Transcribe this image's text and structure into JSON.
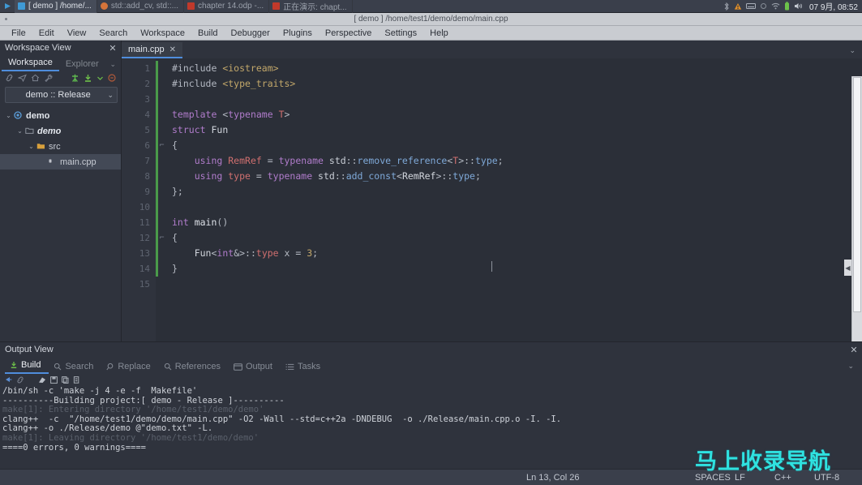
{
  "taskbar": {
    "items": [
      {
        "label": "[ demo ] /home/...",
        "active": true,
        "color": "#3f9ad6"
      },
      {
        "label": "std::add_cv, std::...",
        "active": false,
        "color": "#d4743a"
      },
      {
        "label": "chapter 14.odp -...",
        "active": false,
        "color": "#c0392b"
      },
      {
        "label": "正在演示: chapt...",
        "active": false,
        "color": "#c0392b"
      }
    ],
    "clock": "07 9月, 08:52",
    "tray_icons": [
      "bluetooth-icon",
      "warning-icon",
      "keyboard-icon",
      "display-icon",
      "wifi-icon",
      "battery-icon",
      "volume-icon"
    ]
  },
  "titlebar": {
    "title": "[ demo ] /home/test1/demo/demo/main.cpp"
  },
  "menubar": {
    "items": [
      "File",
      "Edit",
      "View",
      "Search",
      "Workspace",
      "Build",
      "Debugger",
      "Plugins",
      "Perspective",
      "Settings",
      "Help"
    ]
  },
  "sidebar": {
    "title": "Workspace View",
    "close_label": "✕",
    "tabs": [
      {
        "label": "Workspace",
        "active": true
      },
      {
        "label": "Explorer",
        "active": false
      }
    ],
    "tabs_chevron": "⌄",
    "tools": [
      "link-icon",
      "send-icon",
      "home-icon",
      "wrench-icon",
      "run-icon",
      "build-icon",
      "check-icon",
      "stop-icon"
    ],
    "target_combo": {
      "value": "demo :: Release",
      "chevron": "⌄"
    },
    "tree": [
      {
        "depth": 0,
        "twisty": "⌄",
        "icon": "project-icon",
        "label": "demo",
        "style": "bold",
        "selected": false
      },
      {
        "depth": 1,
        "twisty": "⌄",
        "icon": "folder-outline-icon",
        "label": "demo",
        "style": "ital",
        "selected": false
      },
      {
        "depth": 2,
        "twisty": "⌄",
        "icon": "folder-icon",
        "label": "src",
        "style": "plain",
        "selected": false
      },
      {
        "depth": 3,
        "twisty": "",
        "icon": "cpp-file-icon",
        "label": "main.cpp",
        "style": "plain",
        "selected": true
      }
    ]
  },
  "editor": {
    "tab": {
      "label": "main.cpp",
      "close": "✕"
    },
    "chevron": "⌄",
    "line_numbers": [
      "1",
      "2",
      "3",
      "4",
      "5",
      "6",
      "7",
      "8",
      "9",
      "10",
      "11",
      "12",
      "13",
      "14",
      "15"
    ],
    "fold_marks": [
      "",
      "",
      "",
      "",
      "",
      "⌐",
      "",
      "",
      "",
      "",
      "",
      "⌐",
      "",
      "",
      ""
    ],
    "lines": [
      [
        [
          "#include ",
          "k-pre"
        ],
        [
          "<iostream>",
          "k-str"
        ]
      ],
      [
        [
          "#include ",
          "k-pre"
        ],
        [
          "<type_traits>",
          "k-str"
        ]
      ],
      [],
      [
        [
          "template ",
          "k-kw"
        ],
        [
          "<",
          "k-op"
        ],
        [
          "typename ",
          "k-kw"
        ],
        [
          "T",
          "k-tmpl"
        ],
        [
          ">",
          "k-op"
        ]
      ],
      [
        [
          "struct ",
          "k-kw"
        ],
        [
          "Fun",
          "k-ident"
        ]
      ],
      [
        [
          "{",
          "k-op"
        ]
      ],
      [
        [
          "    using ",
          "k-kw"
        ],
        [
          "RemRef",
          "k-tmpl"
        ],
        [
          " = ",
          "k-op"
        ],
        [
          "typename ",
          "k-kw"
        ],
        [
          "std",
          "k-ns"
        ],
        [
          "::",
          "k-op"
        ],
        [
          "remove_reference",
          "k-std"
        ],
        [
          "<",
          "k-op"
        ],
        [
          "T",
          "k-tmpl"
        ],
        [
          ">::",
          "k-op"
        ],
        [
          "type",
          "k-std"
        ],
        [
          ";",
          "k-op"
        ]
      ],
      [
        [
          "    using ",
          "k-kw"
        ],
        [
          "type",
          "k-tmpl"
        ],
        [
          " = ",
          "k-op"
        ],
        [
          "typename ",
          "k-kw"
        ],
        [
          "std",
          "k-ns"
        ],
        [
          "::",
          "k-op"
        ],
        [
          "add_const",
          "k-std"
        ],
        [
          "<",
          "k-op"
        ],
        [
          "RemRef",
          "k-ident"
        ],
        [
          ">::",
          "k-op"
        ],
        [
          "type",
          "k-std"
        ],
        [
          ";",
          "k-op"
        ]
      ],
      [
        [
          "};",
          "k-op"
        ]
      ],
      [],
      [
        [
          "int ",
          "k-kw"
        ],
        [
          "main",
          "k-fn"
        ],
        [
          "()",
          "k-op"
        ]
      ],
      [
        [
          "{",
          "k-op"
        ]
      ],
      [
        [
          "    Fun",
          "k-ident"
        ],
        [
          "<",
          "k-op"
        ],
        [
          "int",
          "k-kw"
        ],
        [
          "&>::",
          "k-op"
        ],
        [
          "type",
          "k-tmpl"
        ],
        [
          " x = ",
          "k-op"
        ],
        [
          "3",
          "k-num"
        ],
        [
          ";",
          "k-op"
        ]
      ],
      [
        [
          "}",
          "k-op"
        ]
      ],
      []
    ]
  },
  "output": {
    "title": "Output View",
    "close_label": "✕",
    "chevron": "⌄",
    "tabs": [
      {
        "label": "Build",
        "icon": "build-icon",
        "active": true
      },
      {
        "label": "Search",
        "icon": "search-icon",
        "active": false
      },
      {
        "label": "Replace",
        "icon": "replace-icon",
        "active": false
      },
      {
        "label": "References",
        "icon": "search-icon",
        "active": false
      },
      {
        "label": "Output",
        "icon": "output-icon",
        "active": false
      },
      {
        "label": "Tasks",
        "icon": "tasks-icon",
        "active": false
      }
    ],
    "tools": [
      "pin-icon",
      "link-icon",
      "clear-icon",
      "save-icon",
      "copy-icon",
      "copy-all-icon"
    ],
    "log": [
      {
        "text": "/bin/sh -c 'make -j 4 -e -f  Makefile'",
        "dim": false
      },
      {
        "text": "----------Building project:[ demo - Release ]----------",
        "dim": false
      },
      {
        "text": "make[1]: Entering directory '/home/test1/demo/demo'",
        "dim": true
      },
      {
        "text": "clang++  -c  \"/home/test1/demo/demo/main.cpp\" -O2 -Wall --std=c++2a -DNDEBUG  -o ./Release/main.cpp.o -I. -I.",
        "dim": false
      },
      {
        "text": "clang++ -o ./Release/demo @\"demo.txt\" -L.",
        "dim": false
      },
      {
        "text": "make[1]: Leaving directory '/home/test1/demo/demo'",
        "dim": true
      },
      {
        "text": "====0 errors, 0 warnings====",
        "dim": false
      }
    ]
  },
  "statusbar": {
    "position": "Ln 13, Col 26",
    "indent": "SPACES",
    "eol": "LF",
    "language": "C++",
    "encoding": "UTF-8"
  },
  "watermark": {
    "text": "马上收录导航",
    "color": "#2fe2e0"
  }
}
